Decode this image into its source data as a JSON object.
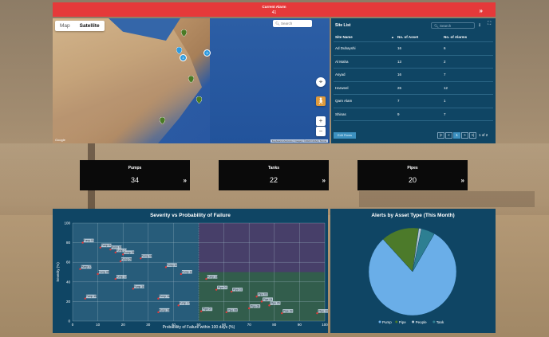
{
  "alarm": {
    "title": "Current Alarm",
    "count": "41",
    "action": "»"
  },
  "map": {
    "tabs": [
      "Map",
      "Satellite"
    ],
    "search_placeholder": "Search",
    "clusters": [
      "3",
      "3"
    ],
    "footer": "Keyboard shortcuts | Imagery ©2023 NASA | Terms",
    "logo": "Google"
  },
  "sites": {
    "title": "Site List",
    "search_placeholder": "Search",
    "columns": [
      "Site Name",
      "No. of Asset",
      "No. of Alarms"
    ],
    "rows": [
      [
        "Ad Dubayshi",
        "16",
        "6"
      ],
      [
        "Al Maha",
        "13",
        "2"
      ],
      [
        "Asyad",
        "16",
        "7"
      ],
      [
        "Harweel",
        "26",
        "12"
      ],
      [
        "Qarn Alam",
        "7",
        "1"
      ],
      [
        "Shinas",
        "9",
        "7"
      ]
    ],
    "export_label": "Edit Rows",
    "pager": [
      "|<",
      "<",
      "1",
      ">",
      ">|"
    ],
    "page_info": "1 of 2"
  },
  "kpis": [
    {
      "name": "Pumps",
      "value": "34",
      "arrow": "»"
    },
    {
      "name": "Tanks",
      "value": "22",
      "arrow": "»"
    },
    {
      "name": "Pipes",
      "value": "20",
      "arrow": "»"
    }
  ],
  "colors": {
    "panel": "#0f4564",
    "alarm": "#e5393a",
    "pump": "#6aaee8",
    "pipe": "#4c7a2a",
    "people": "#b5c7d6",
    "tank": "#2d7f92"
  },
  "chart_data": [
    {
      "type": "scatter",
      "title": "Severity vs Probability of Failure",
      "xlabel": "Probability of Failure within 100 days (%)",
      "ylabel": "Severity (%)",
      "xlim": [
        0,
        100
      ],
      "ylim": [
        0,
        100
      ],
      "xticks": [
        0,
        10,
        20,
        30,
        40,
        50,
        60,
        70,
        80,
        90,
        100
      ],
      "yticks": [
        0,
        20,
        40,
        60,
        80,
        100
      ],
      "grid": true,
      "points": [
        {
          "x": 4,
          "y": 80,
          "label": "Pump 01"
        },
        {
          "x": 11,
          "y": 75,
          "label": "Pump 02"
        },
        {
          "x": 15,
          "y": 73,
          "label": "Pump 03"
        },
        {
          "x": 17,
          "y": 70,
          "label": "Pump 04"
        },
        {
          "x": 20,
          "y": 68,
          "label": "Pump 05"
        },
        {
          "x": 27,
          "y": 64,
          "label": "Pump 06"
        },
        {
          "x": 3,
          "y": 53,
          "label": "Pump 07"
        },
        {
          "x": 10,
          "y": 48,
          "label": "Pump 08"
        },
        {
          "x": 19,
          "y": 61,
          "label": "Pump 09"
        },
        {
          "x": 37,
          "y": 55,
          "label": "Pump 10"
        },
        {
          "x": 43,
          "y": 48,
          "label": "Pump 11"
        },
        {
          "x": 17,
          "y": 43,
          "label": "Pump 12"
        },
        {
          "x": 53,
          "y": 43,
          "label": "Pump 13"
        },
        {
          "x": 24,
          "y": 33,
          "label": "Pump 14"
        },
        {
          "x": 5,
          "y": 23,
          "label": "Pump 15"
        },
        {
          "x": 34,
          "y": 23,
          "label": "Pump 16"
        },
        {
          "x": 42,
          "y": 16,
          "label": "Pump 17"
        },
        {
          "x": 34,
          "y": 9,
          "label": "Pump 18"
        },
        {
          "x": 57,
          "y": 32,
          "label": "Pipe 01"
        },
        {
          "x": 63,
          "y": 30,
          "label": "Pipe 02"
        },
        {
          "x": 73,
          "y": 25,
          "label": "Pipe 03"
        },
        {
          "x": 75,
          "y": 20,
          "label": "Pipe 04"
        },
        {
          "x": 78,
          "y": 16,
          "label": "Pipe 05"
        },
        {
          "x": 70,
          "y": 13,
          "label": "Pipe 06"
        },
        {
          "x": 51,
          "y": 10,
          "label": "Pipe 07"
        },
        {
          "x": 61,
          "y": 9,
          "label": "Pipe 08"
        },
        {
          "x": 83,
          "y": 8,
          "label": "Pipe 09"
        },
        {
          "x": 97,
          "y": 8,
          "label": "Pipe 10"
        }
      ]
    },
    {
      "type": "pie",
      "title": "Alerts by Asset Type (This Month)",
      "legend_position": "bottom",
      "slices": [
        {
          "name": "Pump",
          "value": 80
        },
        {
          "name": "Pipe",
          "value": 14
        },
        {
          "name": "People",
          "value": 1
        },
        {
          "name": "Tank",
          "value": 5
        }
      ]
    }
  ]
}
